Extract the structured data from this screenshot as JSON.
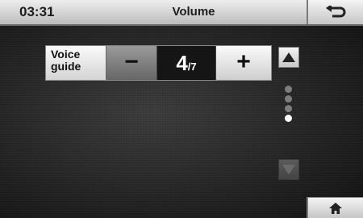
{
  "status_bar": {
    "time": "03:31",
    "title": "Volume"
  },
  "icons": {
    "back": "return-arrow-icon",
    "home": "home-icon",
    "scroll_up": "up-triangle-icon",
    "scroll_down": "down-triangle-icon"
  },
  "setting": {
    "label_line1": "Voice",
    "label_line2": "guide",
    "decrement_label": "−",
    "value_current": "4",
    "value_separator": "/",
    "value_max": "7",
    "increment_label": "+"
  },
  "pagination": {
    "total": 4,
    "active": 4
  },
  "colors": {
    "background": "#262626",
    "button_light": "#e8e8e8",
    "button_dark": "#7a7a7a",
    "active_dot": "#ffffff",
    "inactive_dot": "#7d7d7d"
  }
}
